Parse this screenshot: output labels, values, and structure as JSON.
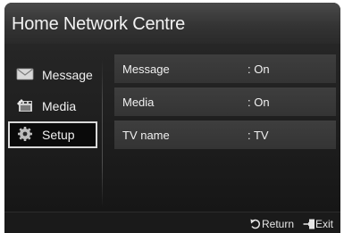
{
  "header": {
    "title": "Home Network Centre"
  },
  "sidebar": {
    "items": [
      {
        "label": "Message",
        "icon": "envelope-icon",
        "selected": false
      },
      {
        "label": "Media",
        "icon": "film-icon",
        "selected": false
      },
      {
        "label": "Setup",
        "icon": "gear-icon",
        "selected": true
      }
    ]
  },
  "main": {
    "rows": [
      {
        "label": "Message",
        "value": ": On"
      },
      {
        "label": "Media",
        "value": ": On"
      },
      {
        "label": "TV name",
        "value": ": TV"
      }
    ]
  },
  "footer": {
    "return_label": "Return",
    "return_icon": "return-arrow-icon",
    "exit_label": "Exit",
    "exit_icon": "exit-icon"
  },
  "colors": {
    "background": "#1d1d1d",
    "title_bar": "#3a3a3a",
    "row": "#3a3a3a",
    "selection_border": "#d9d9d9",
    "text": "#f0f0f0"
  }
}
